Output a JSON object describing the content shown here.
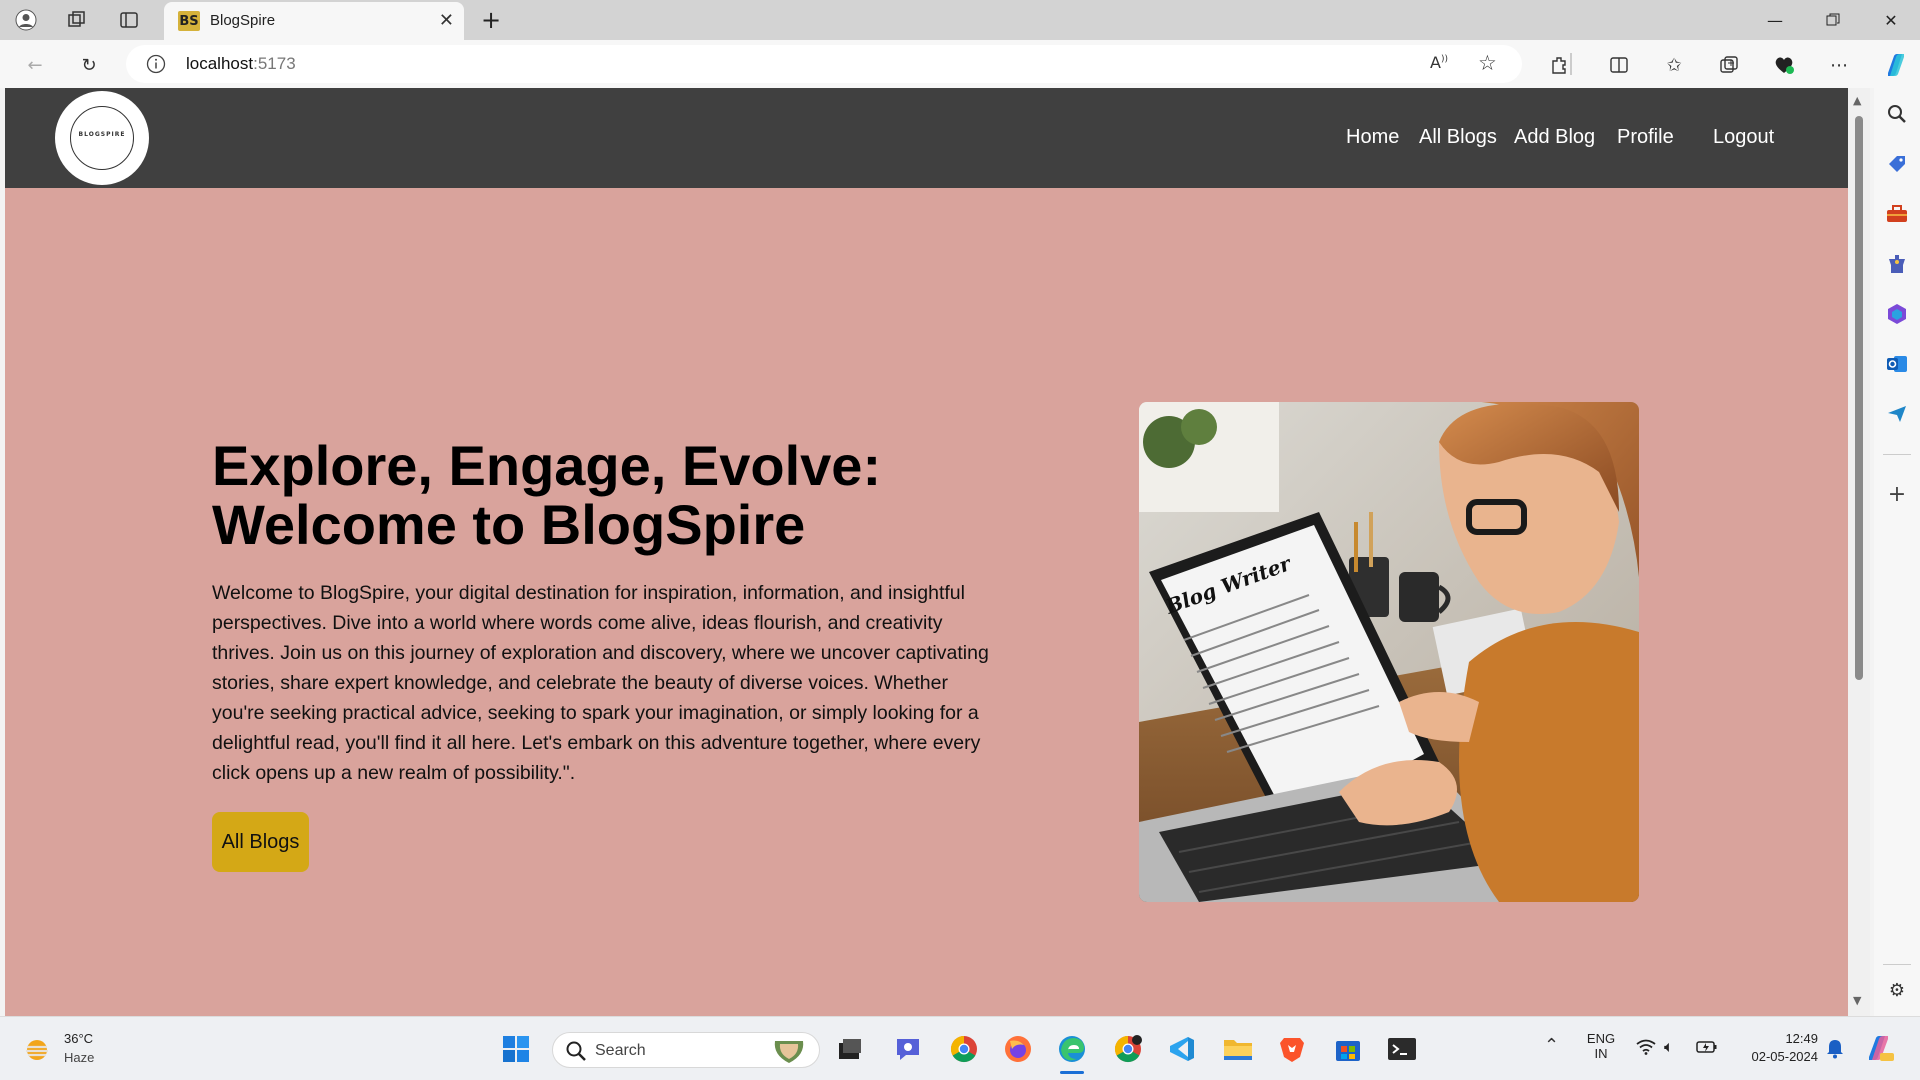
{
  "browser": {
    "tab_title": "BlogSpire",
    "favicon_text": "BS",
    "url_host": "localhost",
    "url_port": ":5173"
  },
  "site": {
    "logo_text": "BLOGSPIRE",
    "nav": [
      "Home",
      "All Blogs",
      "Add Blog",
      "Profile",
      "Logout"
    ]
  },
  "hero": {
    "title_line1": "Explore, Engage, Evolve:",
    "title_line2": "Welcome to BlogSpire",
    "body": "Welcome to BlogSpire, your digital destination for inspiration, information, and insightful perspectives. Dive into a world where words come alive, ideas flourish, and creativity thrives. Join us on this journey of exploration and discovery, where we uncover captivating stories, share expert knowledge, and celebrate the beauty of diverse voices. Whether you're seeking practical advice, seeking to spark your imagination, or simply looking for a delightful read, you'll find it all here. Let's embark on this adventure together, where every click opens up a new realm of possibility.\".",
    "button_label": "All Blogs",
    "image_screen_text": "Blog Writer"
  },
  "colors": {
    "page_bg": "#d9a39c",
    "nav_bg": "#404040",
    "button_bg": "#d4a816"
  },
  "taskbar": {
    "weather_temp": "36°C",
    "weather_desc": "Haze",
    "search_placeholder": "Search",
    "lang_top": "ENG",
    "lang_bottom": "IN",
    "time": "12:49",
    "date": "02-05-2024"
  }
}
